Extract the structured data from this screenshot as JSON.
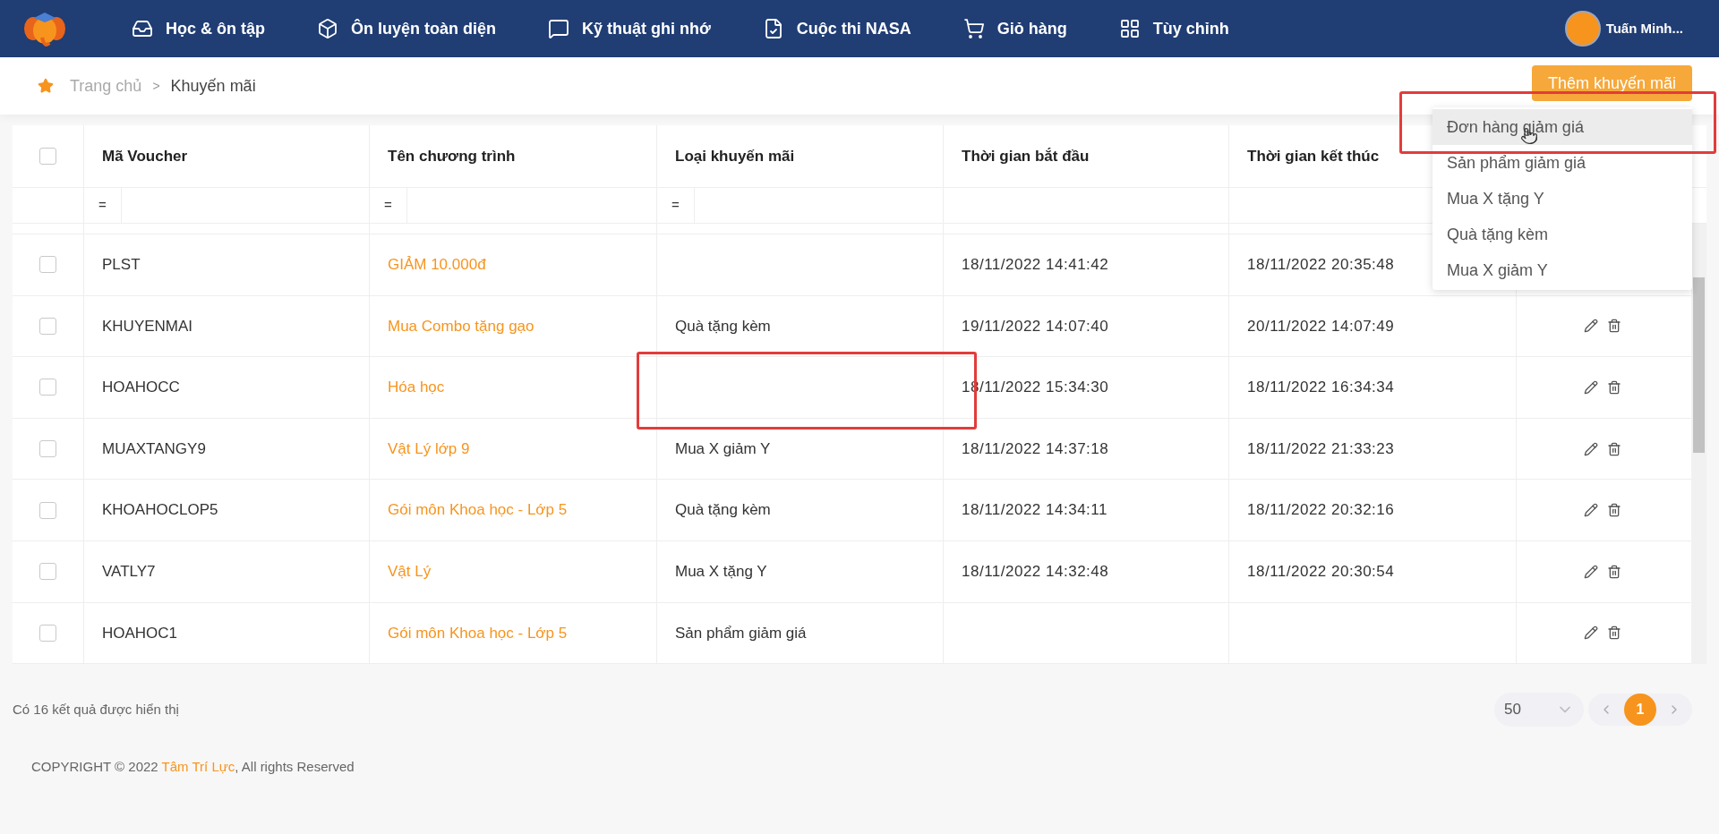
{
  "nav": {
    "items": [
      {
        "label": "Học & ôn tập"
      },
      {
        "label": "Ôn luyện toàn diện"
      },
      {
        "label": "Kỹ thuật ghi nhớ"
      },
      {
        "label": "Cuộc thi NASA"
      },
      {
        "label": "Giỏ hàng"
      },
      {
        "label": "Tùy chỉnh"
      }
    ],
    "user": "Tuấn Minh..."
  },
  "breadcrumb": [
    {
      "label": "Trang chủ"
    },
    {
      "label": ">"
    },
    {
      "label": "Khuyến mãi"
    }
  ],
  "add_button": "Thêm khuyến mãi",
  "menu": [
    {
      "label": "Đơn hàng giảm giá",
      "selected": true
    },
    {
      "label": "Sản phẩm giảm giá",
      "selected": false
    },
    {
      "label": "Mua X tặng Y",
      "selected": false
    },
    {
      "label": "Quà tặng kèm",
      "selected": false
    },
    {
      "label": "Mua X giảm Y",
      "selected": false
    }
  ],
  "table": {
    "select_all": {
      "checked": false
    },
    "columns": [
      {
        "label": "Mã Voucher",
        "filter": "="
      },
      {
        "label": "Tên chương trình",
        "filter": "="
      },
      {
        "label": "Loại khuyến mãi",
        "filter": "="
      },
      {
        "label": "Thời gian bắt đầu"
      },
      {
        "label": "Thời gian kết thúc"
      }
    ],
    "rows": [
      {
        "checked": false,
        "code": "PLST",
        "name": "GIẢM 10.000đ",
        "type": "",
        "start": "18/11/2022 14:41:42",
        "end": "18/11/2022 20:35:48"
      },
      {
        "checked": false,
        "code": "KHUYENMAI",
        "name": "Mua Combo tặng gạo",
        "type": "Quà tặng kèm",
        "start": "19/11/2022 14:07:40",
        "end": "20/11/2022 14:07:49"
      },
      {
        "checked": false,
        "code": "HOAHOCC",
        "name": "Hóa học",
        "type": "",
        "start": "18/11/2022 15:34:30",
        "end": "18/11/2022 16:34:34"
      },
      {
        "checked": false,
        "code": "MUAXTANGY9",
        "name": "Vật Lý lớp 9",
        "type": "Mua X giảm Y",
        "start": "18/11/2022 14:37:18",
        "end": "18/11/2022 21:33:23"
      },
      {
        "checked": false,
        "code": "KHOAHOCLOP5",
        "name": "Gói môn Khoa học - Lớp 5",
        "type": "Quà tặng kèm",
        "start": "18/11/2022 14:34:11",
        "end": "18/11/2022 20:32:16"
      },
      {
        "checked": false,
        "code": "VATLY7",
        "name": "Vật Lý",
        "type": "Mua X tặng Y",
        "start": "18/11/2022 14:32:48",
        "end": "18/11/2022 20:30:54"
      },
      {
        "checked": false,
        "code": "HOAHOC1",
        "name": "Gói môn Khoa học - Lớp 5",
        "type": "Sản phẩm giảm giá",
        "start": "",
        "end": ""
      }
    ]
  },
  "summary": "Có 16 kết quả được hiển thị",
  "page_size": "50",
  "pages": [
    {
      "label": "1",
      "selected": true
    }
  ],
  "footer": {
    "before": "COPYRIGHT © 2022 ",
    "brand": "Tâm Trí Lực",
    "after": ", All rights Reserved"
  }
}
